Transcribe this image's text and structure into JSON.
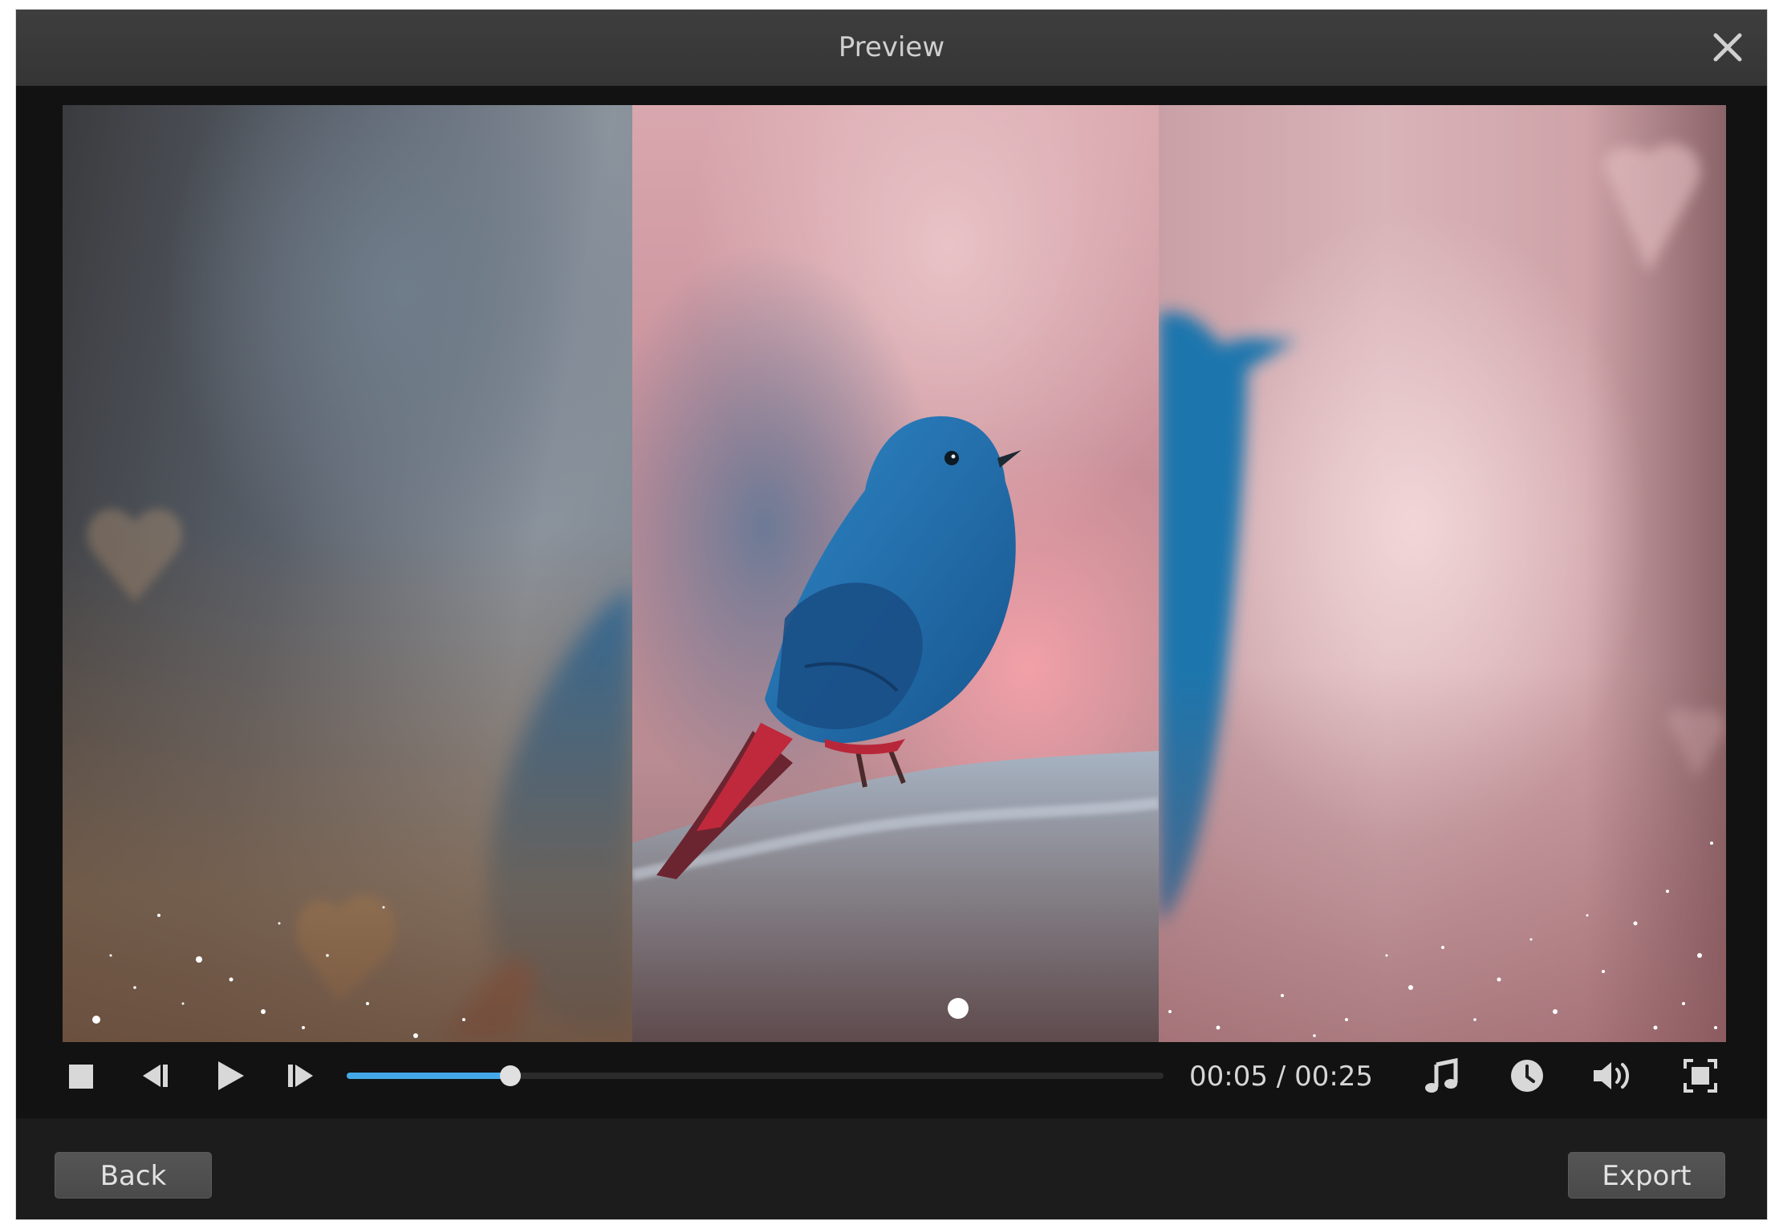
{
  "dialog": {
    "title": "Preview"
  },
  "player": {
    "current_time": "00:05",
    "separator": "/",
    "total_time": "00:25",
    "progress": 0.2
  },
  "footer": {
    "back_label": "Back",
    "export_label": "Export"
  },
  "icons": {
    "close": "close-icon",
    "stop": "stop-icon",
    "previous_frame": "previous-frame-icon",
    "play": "play-icon",
    "next_frame": "next-frame-icon",
    "music": "music-note-icon",
    "duration": "clock-icon",
    "volume": "volume-icon",
    "fullscreen": "fullscreen-icon"
  },
  "colors": {
    "accent": "#44a8e8",
    "bird_blue": "#1f6fb0",
    "bird_red": "#c0283c"
  }
}
